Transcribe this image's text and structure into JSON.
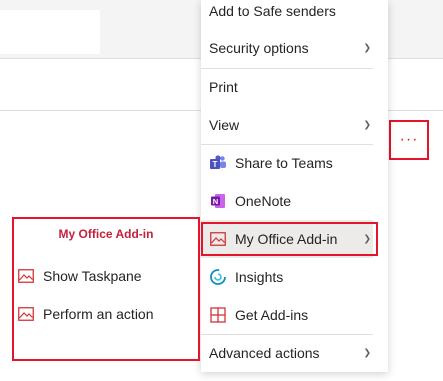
{
  "menu": {
    "items": [
      {
        "label": "Add to Safe senders"
      },
      {
        "label": "Security options",
        "has_submenu": true
      },
      {
        "label": "Print"
      },
      {
        "label": "View",
        "has_submenu": true
      },
      {
        "label": "Share to Teams",
        "icon": "teams-icon"
      },
      {
        "label": "OneNote",
        "icon": "onenote-icon"
      },
      {
        "label": "My Office Add-in",
        "icon": "addin-image-icon",
        "has_submenu": true,
        "hovered": true
      },
      {
        "label": "Insights",
        "icon": "insights-icon"
      },
      {
        "label": "Get Add-ins",
        "icon": "get-addins-icon"
      },
      {
        "label": "Advanced actions",
        "has_submenu": true
      }
    ]
  },
  "more_button": {
    "label": "···"
  },
  "submenu": {
    "header": "My Office Add-in",
    "items": [
      {
        "label": "Show Taskpane",
        "icon": "addin-image-icon"
      },
      {
        "label": "Perform an action",
        "icon": "addin-image-icon"
      }
    ]
  },
  "colors": {
    "highlight": "#e3142c",
    "submenu_header": "#c4213e",
    "teams": "#5059c9",
    "onenote": "#7719aa",
    "insights": "#0f8fbf",
    "get_addins": "#d13438"
  }
}
